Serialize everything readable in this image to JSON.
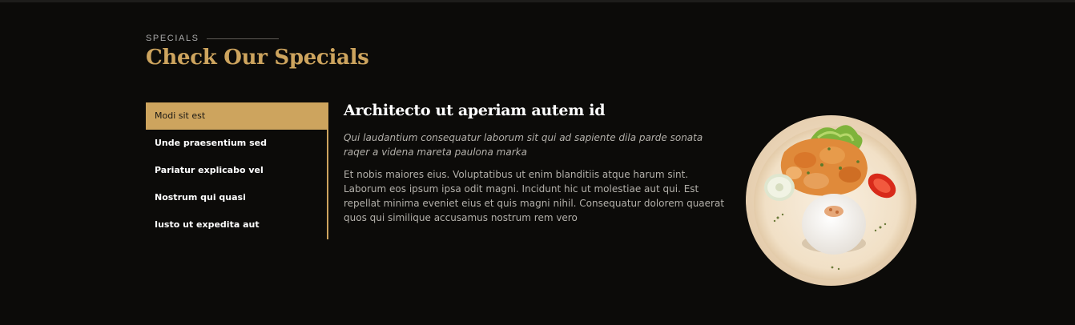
{
  "section": {
    "eyebrow": "Specials",
    "title": "Check Our Specials"
  },
  "tabs": [
    {
      "label": "Modi sit est",
      "active": true
    },
    {
      "label": "Unde praesentium sed",
      "active": false
    },
    {
      "label": "Pariatur explicabo vel",
      "active": false
    },
    {
      "label": "Nostrum qui quasi",
      "active": false
    },
    {
      "label": "Iusto ut expedita aut",
      "active": false
    }
  ],
  "detail": {
    "title": "Architecto ut aperiam autem id",
    "lead": "Qui laudantium consequatur laborum sit qui ad sapiente dila parde sonata raqer a videna mareta paulona marka",
    "body": "Et nobis maiores eius. Voluptatibus ut enim blanditiis atque harum sint. Laborum eos ipsum ipsa odit magni. Incidunt hic ut molestiae aut qui. Est repellat minima eveniet eius et quis magni nihil. Consequatur dolorem quaerat quos qui similique accusamus nostrum rem vero"
  },
  "colors": {
    "accent": "#cda45e",
    "background": "#0c0b09",
    "text_muted": "#b3b0aa"
  },
  "icons": {
    "dish_image": "food-plate-image"
  }
}
